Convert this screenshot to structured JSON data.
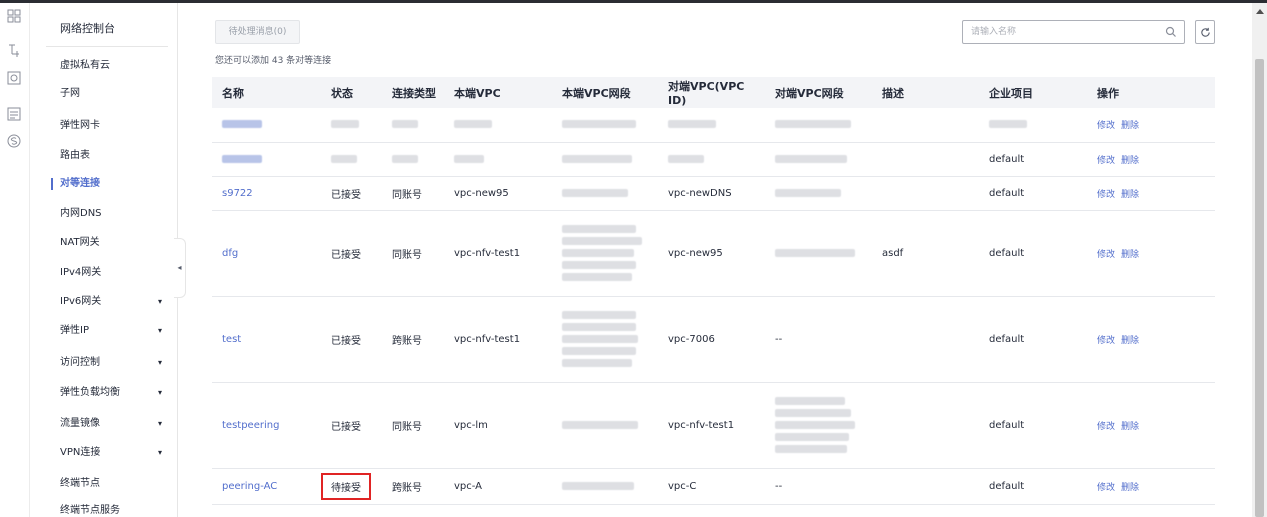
{
  "sidebar": {
    "title": "网络控制台",
    "items": [
      {
        "label": "虚拟私有云",
        "has_caret": false,
        "active": false
      },
      {
        "label": "子网",
        "has_caret": false,
        "active": false
      },
      {
        "label": "弹性网卡",
        "has_caret": false,
        "active": false
      },
      {
        "label": "路由表",
        "has_caret": false,
        "active": false
      },
      {
        "label": "对等连接",
        "has_caret": false,
        "active": true
      },
      {
        "label": "内网DNS",
        "has_caret": false,
        "active": false
      },
      {
        "label": "NAT网关",
        "has_caret": false,
        "active": false
      },
      {
        "label": "IPv4网关",
        "has_caret": false,
        "active": false
      },
      {
        "label": "IPv6网关",
        "has_caret": true,
        "active": false
      },
      {
        "label": "弹性IP",
        "has_caret": true,
        "active": false
      },
      {
        "label": "访问控制",
        "has_caret": true,
        "active": false
      },
      {
        "label": "弹性负载均衡",
        "has_caret": true,
        "active": false
      },
      {
        "label": "流量镜像",
        "has_caret": true,
        "active": false
      },
      {
        "label": "VPN连接",
        "has_caret": true,
        "active": false
      },
      {
        "label": "终端节点",
        "has_caret": false,
        "active": false
      },
      {
        "label": "终端节点服务",
        "has_caret": false,
        "active": false
      }
    ],
    "caret": "▾",
    "collapse_glyph": "◂"
  },
  "toolbar": {
    "pending_label": "待处理消息(0)",
    "hint": "您还可以添加 43 条对等连接",
    "search_placeholder": "请输入名称"
  },
  "table": {
    "headers": [
      "名称",
      "状态",
      "连接类型",
      "本端VPC",
      "本端VPC网段",
      "对端VPC(VPC ID)",
      "对端VPC网段",
      "描述",
      "企业项目",
      "操作"
    ],
    "op_modify": "修改",
    "op_delete": "删除",
    "rows": [
      {
        "name": "",
        "status": "",
        "type": "",
        "local_vpc": "",
        "peer_vpc": "",
        "peer_cidr": "",
        "desc": "",
        "project": ""
      },
      {
        "name": "",
        "status": "",
        "type": "",
        "local_vpc": "",
        "peer_vpc": "",
        "peer_cidr": "",
        "desc": "",
        "project": "default"
      },
      {
        "name": "s9722",
        "status": "已接受",
        "type": "同账号",
        "local_vpc": "vpc-new95",
        "peer_vpc": "vpc-newDNS",
        "peer_cidr": "",
        "desc": "",
        "project": "default"
      },
      {
        "name": "dfg",
        "status": "已接受",
        "type": "同账号",
        "local_vpc": "vpc-nfv-test1",
        "peer_vpc": "vpc-new95",
        "peer_cidr": "",
        "desc": "asdf",
        "project": "default"
      },
      {
        "name": "test",
        "status": "已接受",
        "type": "跨账号",
        "local_vpc": "vpc-nfv-test1",
        "peer_vpc": "vpc-7006",
        "peer_cidr": "--",
        "desc": "",
        "project": "default"
      },
      {
        "name": "testpeering",
        "status": "已接受",
        "type": "同账号",
        "local_vpc": "vpc-lm",
        "peer_vpc": "vpc-nfv-test1",
        "peer_cidr": "",
        "desc": "",
        "project": "default"
      },
      {
        "name": "peering-AC",
        "status": "待接受",
        "type": "跨账号",
        "local_vpc": "vpc-A",
        "peer_vpc": "vpc-C",
        "peer_cidr": "--",
        "desc": "",
        "project": "default"
      }
    ]
  },
  "colors": {
    "accent": "#526ecc",
    "highlight_border": "#e02424",
    "header_bg": "#f3f4f7"
  }
}
